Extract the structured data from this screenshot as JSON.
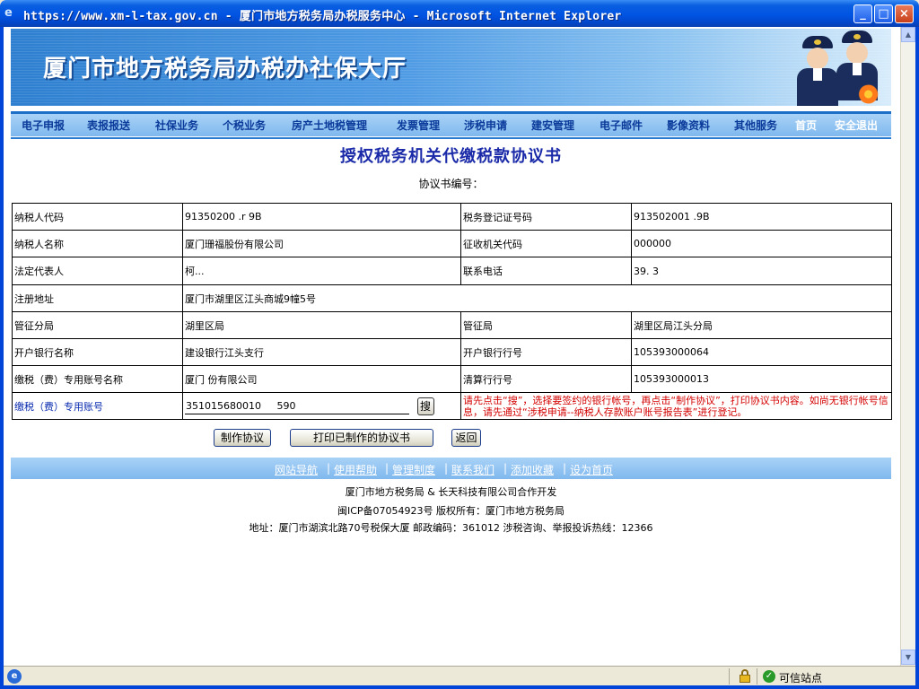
{
  "window": {
    "title": "https://www.xm-l-tax.gov.cn - 厦门市地方税务局办税服务中心 - Microsoft Internet Explorer",
    "min_label": "_",
    "max_label": "□",
    "close_label": "×"
  },
  "banner": {
    "title": "厦门市地方税务局办税办社保大厅"
  },
  "nav": {
    "items": [
      "电子申报",
      "表报报送",
      "社保业务",
      "个税业务",
      "房产土地税管理",
      "发票管理",
      "涉税申请",
      "建安管理",
      "电子邮件",
      "影像资料",
      "其他服务",
      "首页",
      "安全退出"
    ]
  },
  "document": {
    "title": "授权税务机关代缴税款协议书",
    "number_label": "协议书编号："
  },
  "form": {
    "taxpayer_code_label": "纳税人代码",
    "taxpayer_code_value": "91350200  .r    9B",
    "tax_reg_no_label": "税务登记证号码",
    "tax_reg_no_value": "913502001    .9B",
    "taxpayer_name_label": "纳税人名称",
    "taxpayer_name_value": "厦门珊福股份有限公司",
    "collection_org_label": "征收机关代码",
    "collection_org_value": "000000",
    "legal_rep_label": "法定代表人",
    "legal_rep_value": "柯...",
    "phone_label": "联系电话",
    "phone_value": "39.   3",
    "address_label": "注册地址",
    "address_value": "厦门市湖里区江头商城9幢5号",
    "branch_label": "管征分局",
    "branch_value": "湖里区局",
    "bureau_label": "管征局",
    "bureau_value": "湖里区局江头分局",
    "bank_name_label": "开户银行名称",
    "bank_name_value": "建设银行江头支行",
    "bank_no_label": "开户银行行号",
    "bank_no_value": "105393000064",
    "account_name_label": "缴税（费）专用账号名称",
    "account_name_value": "厦门      份有限公司",
    "clearing_no_label": "清算行行号",
    "clearing_no_value": "105393000013",
    "account_label": "缴税（费）专用账号",
    "account_value": "351015680010     590",
    "search_label": "搜",
    "hint": "请先点击“搜”，选择要签约的银行帐号，再点击“制作协议”，打印协议书内容。如尚无银行帐号信息，请先通过“涉税申请--纳税人存款账户账号报告表”进行登记。"
  },
  "buttons": {
    "make": "制作协议",
    "print": "打印已制作的协议书",
    "back": "返回"
  },
  "footer": {
    "links": [
      "网站导航",
      "使用帮助",
      "管理制度",
      "联系我们",
      "添加收藏",
      "设为首页"
    ],
    "sep": "|",
    "line1": "厦门市地方税务局 & 长天科技有限公司合作开发",
    "line2": "闽ICP备07054923号   版权所有：厦门市地方税务局",
    "line3": "地址：厦门市湖滨北路70号税保大厦      邮政编码：361012      涉税咨询、举报投诉热线：12366"
  },
  "statusbar": {
    "zone": "可信站点"
  },
  "colors": {
    "nav_text": "#0a3a9a",
    "hint": "#d40000",
    "title": "#1a2aa8",
    "titlebar": "#0054e3"
  },
  "icons": [
    "ie-icon",
    "lock-icon",
    "trusted-site-icon",
    "officer-image",
    "flower-image"
  ]
}
